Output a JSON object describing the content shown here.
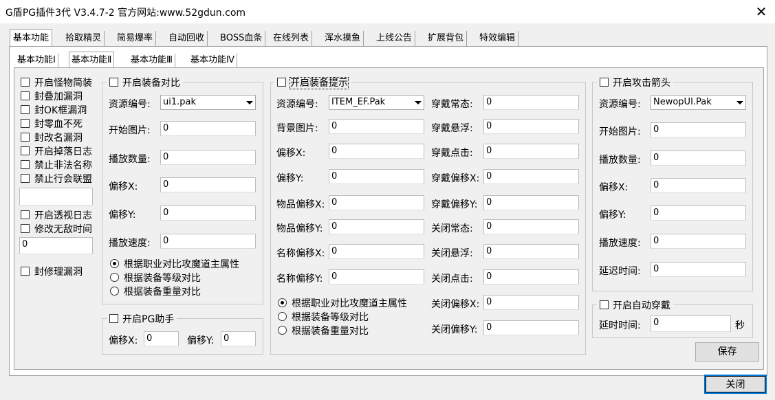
{
  "window": {
    "title": "G盾PG插件3代 V3.4.7-2  官方网站:www.52gdun.com"
  },
  "main_tabs": [
    "基本功能",
    "拾取精灵",
    "简易爆率",
    "自动回收",
    "BOSS血条",
    "在线列表",
    "浑水摸鱼",
    "上线公告",
    "扩展背包",
    "特效编辑"
  ],
  "sub_tabs": [
    "基本功能Ⅰ",
    "基本功能Ⅱ",
    "基本功能Ⅲ",
    "基本功能Ⅳ"
  ],
  "left_options": {
    "items": [
      "开启怪物简装",
      "封叠加漏洞",
      "封OK框漏洞",
      "封零血不死",
      "封改名漏洞",
      "开启掉落日志",
      "禁止非法名称",
      "禁止行会联盟"
    ],
    "blank_input": "",
    "items2": [
      "开启透视日志",
      "修改无敌时间"
    ],
    "invincible_value": "0",
    "repair_label": "封修理漏洞"
  },
  "equip_compare": {
    "title": "开启装备对比",
    "res_label": "资源编号:",
    "res_value": "ui1.pak",
    "start_label": "开始图片:",
    "start_value": "0",
    "count_label": "播放数量:",
    "count_value": "0",
    "offx_label": "偏移X:",
    "offx_value": "0",
    "offy_label": "偏移Y:",
    "offy_value": "0",
    "speed_label": "播放速度:",
    "speed_value": "0",
    "radios": [
      "根据职业对比攻魔道主属性",
      "根据装备等级对比",
      "根据装备重量对比"
    ]
  },
  "pg_helper": {
    "title": "开启PG助手",
    "offx_label": "偏移X:",
    "offx_value": "0",
    "offy_label": "偏移Y:",
    "offy_value": "0"
  },
  "equip_tip": {
    "title": "开启装备提示",
    "res_label": "资源编号:",
    "res_value": "ITEM_EF.Pak",
    "bg_label": "背景图片:",
    "bg_value": "0",
    "offx_label": "偏移X:",
    "offx_value": "0",
    "offy_label": "偏移Y:",
    "offy_value": "0",
    "item_offx_label": "物品偏移X:",
    "item_offx_value": "0",
    "item_offy_label": "物品偏移Y:",
    "item_offy_value": "0",
    "name_offx_label": "名称偏移X:",
    "name_offx_value": "0",
    "name_offy_label": "名称偏移Y:",
    "name_offy_value": "0",
    "radios": [
      "根据职业对比攻魔道主属性",
      "根据装备等级对比",
      "根据装备重量对比"
    ],
    "right": [
      {
        "label": "穿戴常态:",
        "value": "0"
      },
      {
        "label": "穿戴悬浮:",
        "value": "0"
      },
      {
        "label": "穿戴点击:",
        "value": "0"
      },
      {
        "label": "穿戴偏移X:",
        "value": "0"
      },
      {
        "label": "穿戴偏移Y:",
        "value": "0"
      },
      {
        "label": "关闭常态:",
        "value": "0"
      },
      {
        "label": "关闭悬浮:",
        "value": "0"
      },
      {
        "label": "关闭点击:",
        "value": "0"
      },
      {
        "label": "关闭偏移X:",
        "value": "0"
      },
      {
        "label": "关闭偏移Y:",
        "value": "0"
      }
    ]
  },
  "attack_arrow": {
    "title": "开启攻击箭头",
    "res_label": "资源编号:",
    "res_value": "NewopUI.Pak",
    "start_label": "开始图片:",
    "start_value": "0",
    "count_label": "播放数量:",
    "count_value": "0",
    "offx_label": "偏移X:",
    "offx_value": "0",
    "offy_label": "偏移Y:",
    "offy_value": "0",
    "speed_label": "播放速度:",
    "speed_value": "0",
    "delay_label": "延迟时间:",
    "delay_value": "0"
  },
  "auto_equip": {
    "title": "开启自动穿戴",
    "delay_label": "延时时间:",
    "delay_value": "0",
    "unit": "秒"
  },
  "buttons": {
    "save": "保存",
    "close": "关闭"
  }
}
